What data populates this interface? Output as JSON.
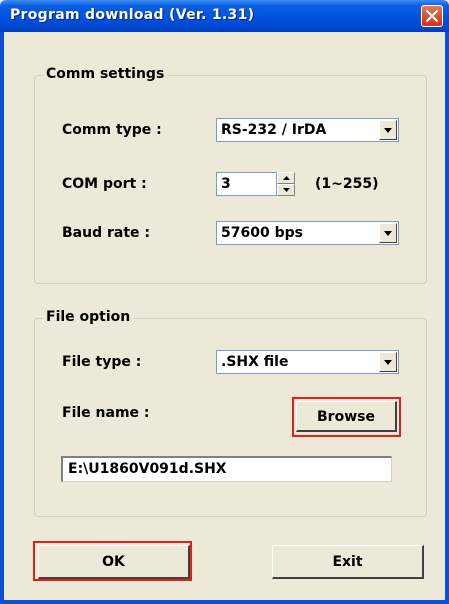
{
  "window": {
    "title": "Program download  (Ver. 1.31)",
    "close_icon": "close-icon"
  },
  "comm_settings": {
    "group_label": "Comm settings",
    "comm_type_label": "Comm type :",
    "comm_type_value": "RS-232 / IrDA",
    "com_port_label": "COM port :",
    "com_port_value": "3",
    "com_port_range": "(1~255)",
    "baud_rate_label": "Baud rate :",
    "baud_rate_value": "57600 bps"
  },
  "file_option": {
    "group_label": "File option",
    "file_type_label": "File type :",
    "file_type_value": ".SHX file",
    "file_name_label": "File name :",
    "browse_label": "Browse",
    "file_path": "E:\\U1860V091d.SHX"
  },
  "buttons": {
    "ok_label": "OK",
    "exit_label": "Exit"
  },
  "colors": {
    "titlebar": "#0054e3",
    "highlight": "#e02020",
    "face": "#ece9d8"
  }
}
